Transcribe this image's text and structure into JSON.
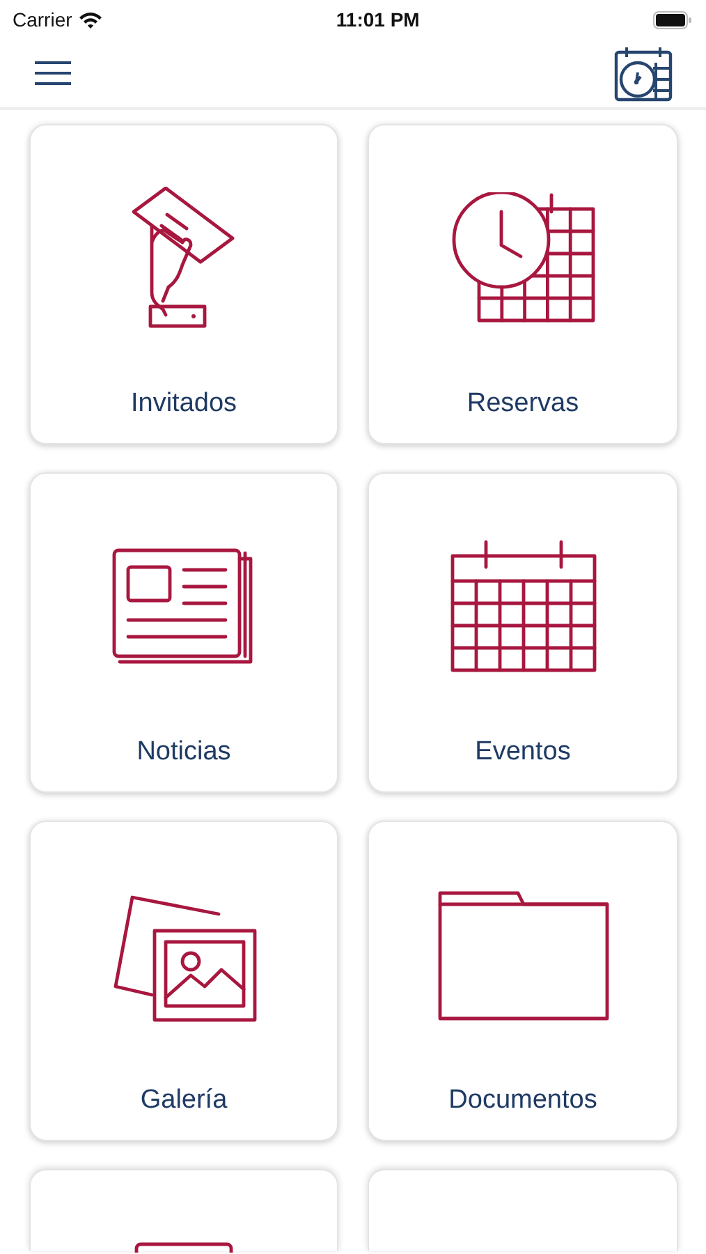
{
  "status_bar": {
    "carrier": "Carrier",
    "time": "11:01 PM"
  },
  "tiles": [
    {
      "kind": "labeled",
      "label": "Invitados"
    },
    {
      "kind": "labeled",
      "label": "Reservas"
    },
    {
      "kind": "labeled",
      "label": "Noticias"
    },
    {
      "kind": "labeled",
      "label": "Eventos"
    },
    {
      "kind": "labeled",
      "label": "Galería"
    },
    {
      "kind": "labeled",
      "label": "Documentos"
    },
    {
      "kind": "partial"
    },
    {
      "kind": "partial"
    }
  ]
}
